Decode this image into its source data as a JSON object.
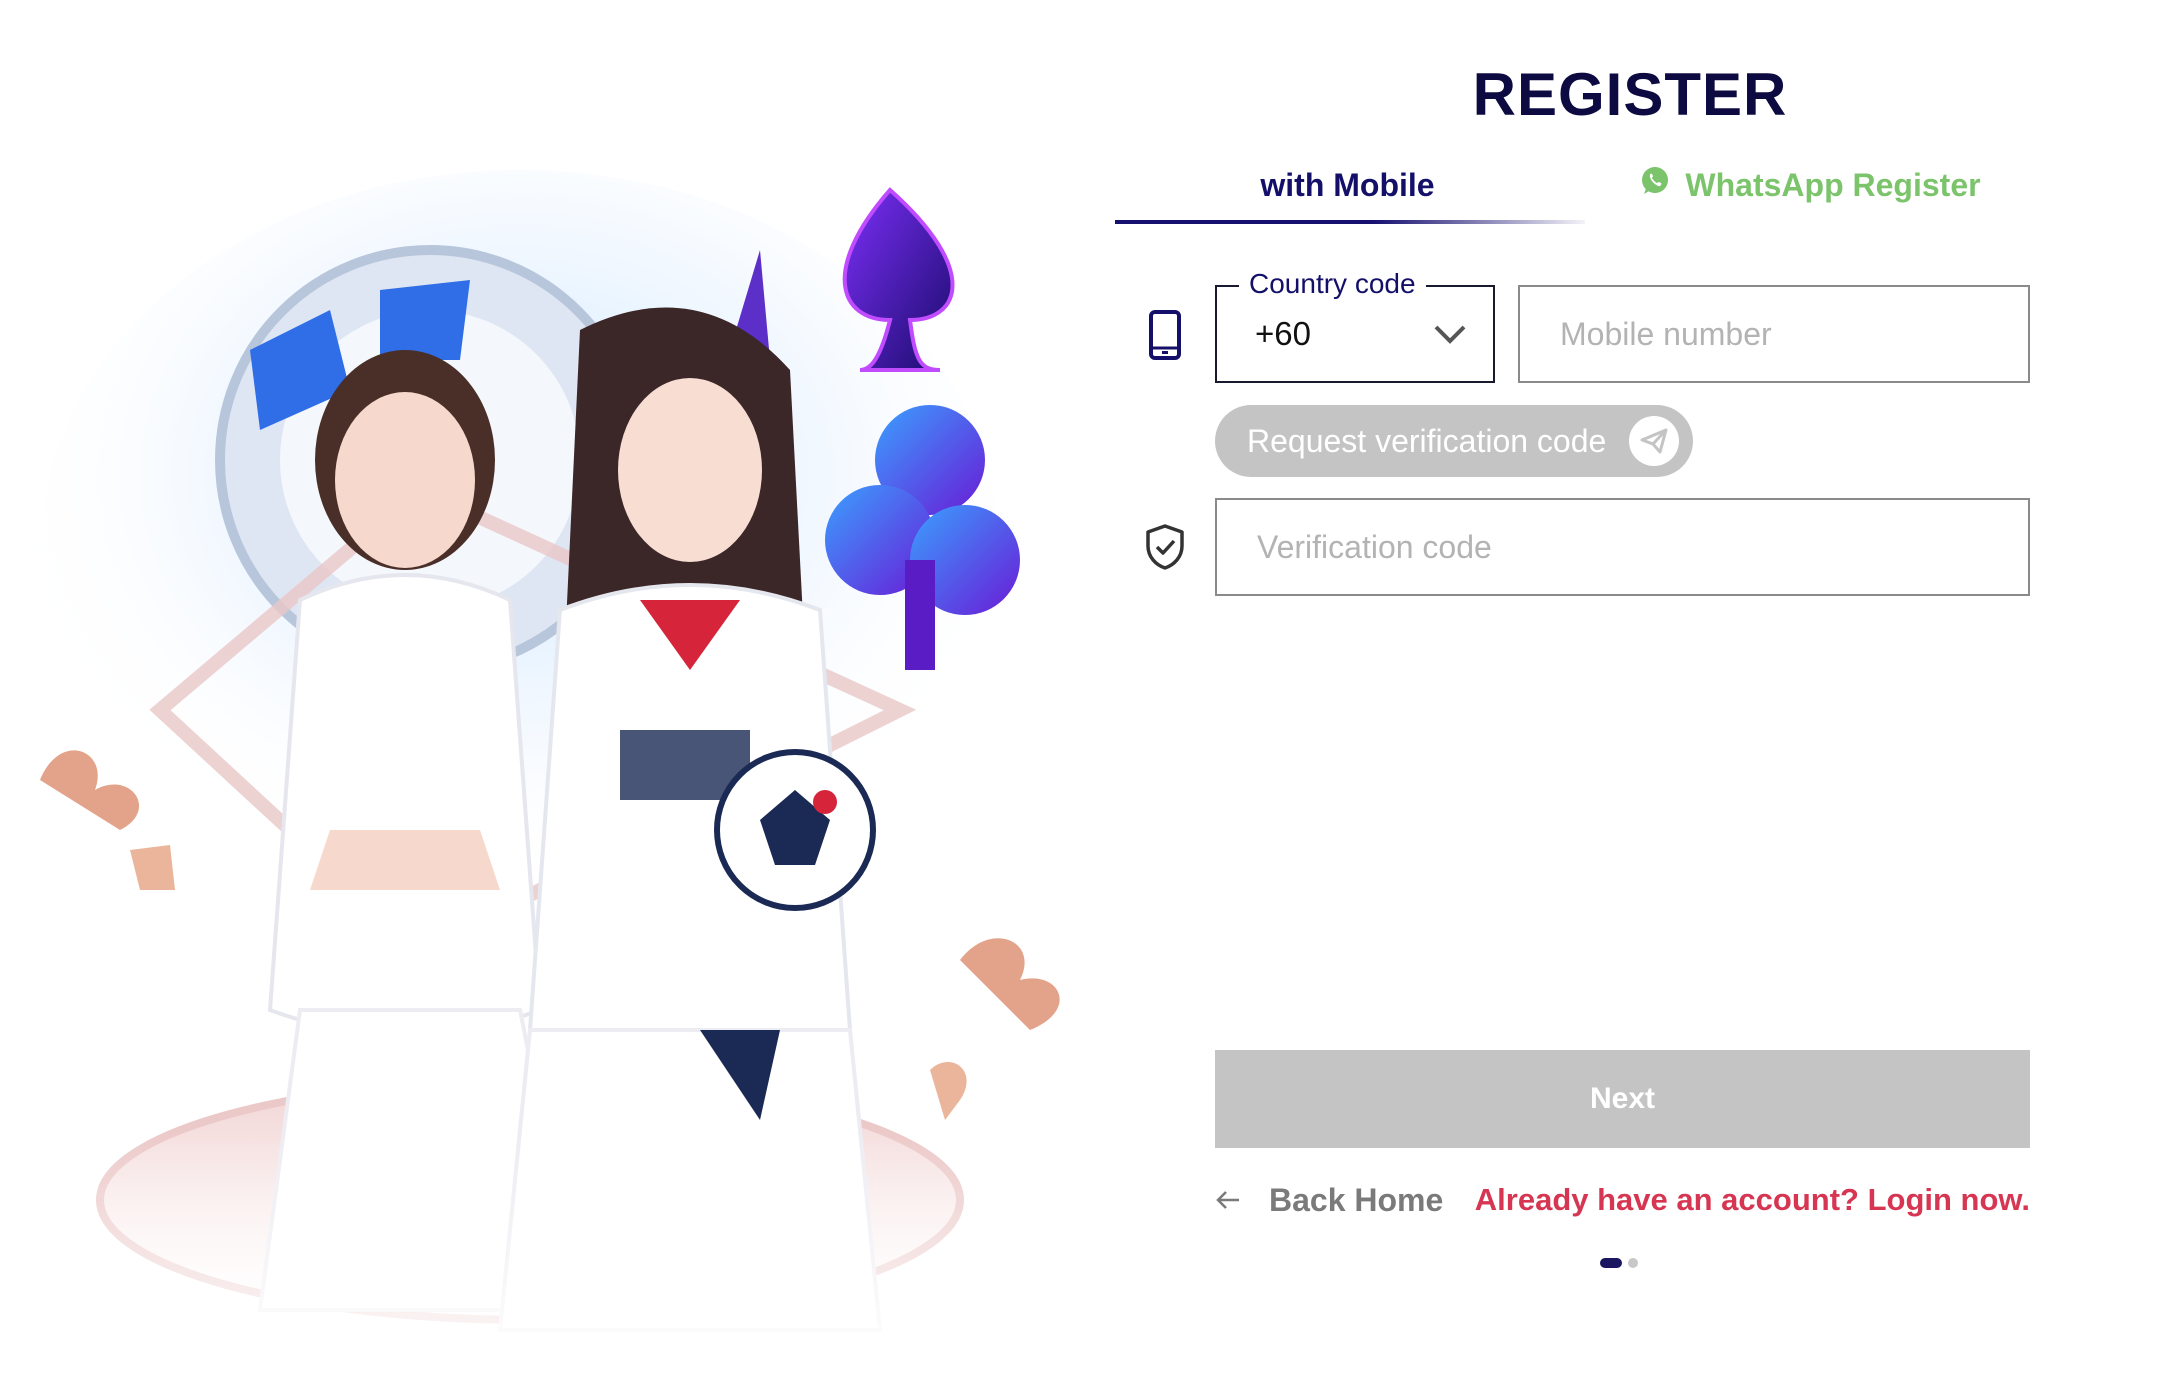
{
  "header": {
    "title": "REGISTER"
  },
  "tabs": [
    {
      "label": "with Mobile",
      "active": true
    },
    {
      "label": "WhatsApp Register",
      "active": false,
      "icon": "whatsapp-icon"
    }
  ],
  "form": {
    "country_code": {
      "legend": "Country code",
      "value": "+60"
    },
    "mobile": {
      "placeholder": "Mobile number",
      "value": ""
    },
    "request_button": {
      "label": "Request verification code",
      "icon": "send-icon"
    },
    "verification": {
      "placeholder": "Verification code",
      "value": ""
    },
    "next_button": {
      "label": "Next"
    }
  },
  "footer": {
    "back_home": "Back Home",
    "login_link": "Already have an account? Login now."
  },
  "pagination": {
    "current": 1,
    "total": 2
  },
  "colors": {
    "title": "#0c0a40",
    "tab_active": "#14106a",
    "whatsapp": "#7cc46b",
    "disabled_button": "#c4c4c4",
    "login_link": "#d63652"
  }
}
